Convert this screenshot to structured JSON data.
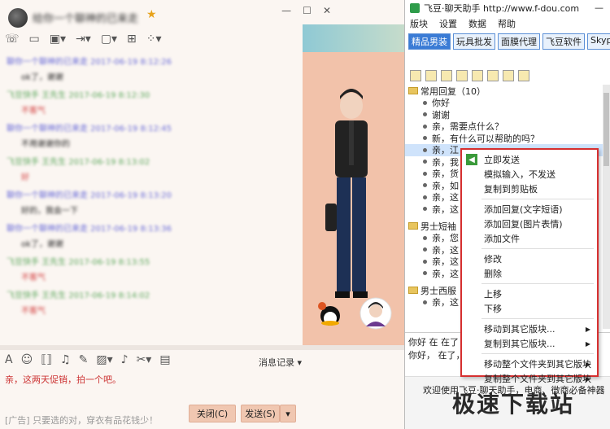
{
  "qq": {
    "contact_name": "给你一个聊神的已来走",
    "toolbar_icons": [
      "phone-icon",
      "video-icon",
      "screen-share-icon",
      "transfer-icon",
      "remote-icon",
      "add-member-icon",
      "apps-icon"
    ],
    "messages": [
      {
        "head": "聊你一个聊神的已来走 2017-06-19 8:12:26",
        "color": "blue",
        "body": "ok了，谢谢"
      },
      {
        "head": "飞豆快手 王先生 2017-06-19 8:12:30",
        "color": "green",
        "body": "不客气",
        "red": true
      },
      {
        "head": "聊你一个聊神的已来走 2017-06-19 8:12:45",
        "color": "blue",
        "body": "不用谢谢你的"
      },
      {
        "head": "飞豆快手 王先生 2017-06-19 8:13:02",
        "color": "green",
        "body": "好",
        "red": true
      },
      {
        "head": "聊你一个聊神的已来走 2017-06-19 8:13:20",
        "color": "blue",
        "body": "好的，我会一下"
      },
      {
        "head": "聊你一个聊神的已来走 2017-06-19 8:13:36",
        "color": "blue",
        "body": "ok了，谢谢"
      },
      {
        "head": "飞豆快手 王先生 2017-06-19 8:13:55",
        "color": "green",
        "body": "不客气",
        "red": true
      },
      {
        "head": "飞豆快手 王先生 2017-06-19 8:14:02",
        "color": "green",
        "body": "不客气",
        "red": true
      }
    ],
    "history_label": "消息记录 ▾",
    "input_text": "亲，这两天促销，拍一个吧。",
    "tip": "[广告] 只要选的对，穿衣有品花钱少！",
    "close_btn": "关闭(C)",
    "send_btn": "发送(S)"
  },
  "feidou": {
    "title": "飞豆·聊天助手 http://www.f-dou.com",
    "menu": [
      "版块",
      "设置",
      "数据",
      "帮助"
    ],
    "tabs": [
      "精品男装",
      "玩具批发",
      "面膜代理",
      "飞豆软件",
      "Skype"
    ],
    "folders": [
      {
        "label": "常用回复（10）",
        "items": [
          "你好",
          "谢谢",
          "亲，需要点什么？",
          "新，有什么可以帮助的吗？",
          "亲，江",
          "亲，我",
          "亲，货",
          "亲，如",
          "亲，这",
          "亲，这"
        ]
      },
      {
        "label": "男士短袖",
        "items": [
          "亲，您",
          "亲，这",
          "亲，这",
          "亲，这"
        ]
      },
      {
        "label": "男士西服",
        "items": [
          "亲，这"
        ]
      }
    ],
    "preview_lines": [
      "你好  在  在了",
      "你好，  在了，"
    ],
    "welcome": "欢迎使用飞豆·聊天助手，电商、微商必备神器"
  },
  "context_menu": {
    "groups": [
      [
        "立即发送",
        "模拟输入，不发送",
        "复制到剪贴板"
      ],
      [
        "添加回复(文字短语)",
        "添加回复(图片表情)",
        "添加文件"
      ],
      [
        "修改",
        "删除"
      ],
      [
        "上移",
        "下移"
      ],
      [
        "移动到其它版块...",
        "复制到其它版块..."
      ],
      [
        "移动整个文件夹到其它版块",
        "复制整个文件夹到其它版块"
      ]
    ]
  },
  "watermark": "极速下载站"
}
